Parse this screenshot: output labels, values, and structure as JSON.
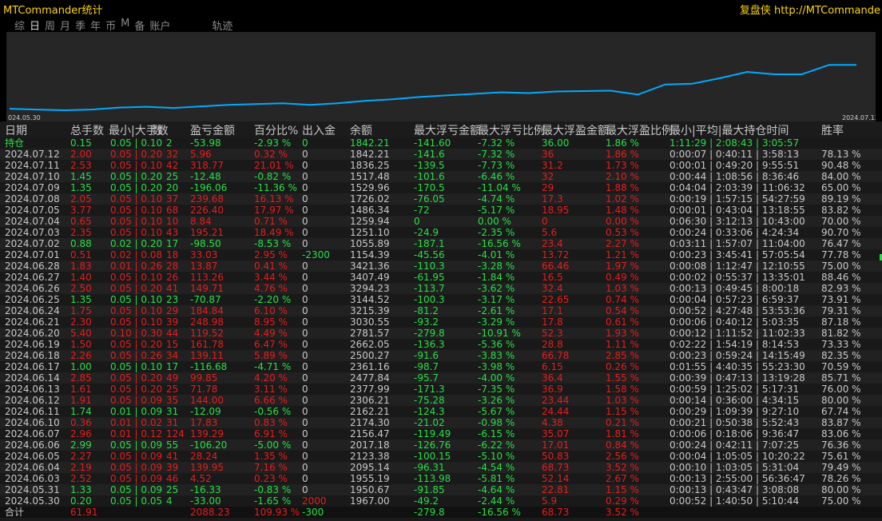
{
  "app": {
    "title": "MTCommander统计",
    "brand": "复盘侠 http://MTCommande"
  },
  "tabs": [
    {
      "label": "综",
      "active": false
    },
    {
      "label": "日",
      "active": true
    },
    {
      "label": "周",
      "active": false
    },
    {
      "label": "月",
      "active": false
    },
    {
      "label": "季",
      "active": false
    },
    {
      "label": "年",
      "active": false
    },
    {
      "label": "币",
      "active": false
    },
    {
      "label": "M",
      "active": false
    },
    {
      "label": "备",
      "active": false
    },
    {
      "label": "账户",
      "active": false
    },
    {
      "label": "轨迹",
      "active": false
    }
  ],
  "chart_data": {
    "type": "line",
    "x_start_label": "024.05.30",
    "x_end_label": "2024.07.12",
    "ylim": [
      1940,
      2800
    ],
    "series": [
      {
        "color": "#00aaff",
        "x": [
          "2024.05.30",
          "2024.05.31",
          "2024.06.03",
          "2024.06.04",
          "2024.06.05",
          "2024.06.06",
          "2024.06.07",
          "2024.06.10",
          "2024.06.11",
          "2024.06.12",
          "2024.06.13",
          "2024.06.14",
          "2024.06.17",
          "2024.06.18",
          "2024.06.19",
          "2024.06.20",
          "2024.06.21",
          "2024.06.24",
          "2024.06.25",
          "2024.06.26",
          "2024.06.27",
          "2024.06.28",
          "2024.07.01",
          "2024.07.02",
          "2024.07.03",
          "2024.07.04",
          "2024.07.05",
          "2024.07.08",
          "2024.07.09",
          "2024.07.10",
          "2024.07.11",
          "2024.07.12"
        ],
        "values": [
          1967.0,
          1950.67,
          1955.19,
          2095.14,
          2123.38,
          2017.18,
          2156.47,
          2174.3,
          2162.21,
          2306.21,
          2377.99,
          2477.84,
          2361.16,
          2500.27,
          2662.05,
          2781.57,
          3030.55,
          3215.39,
          3144.52,
          3294.23,
          3407.49,
          3421.36,
          1154.39,
          1055.89,
          1251.1,
          1259.94,
          1486.34,
          1726.02,
          1529.96,
          1517.48,
          1836.25,
          1842.21
        ]
      }
    ]
  },
  "equity_curve_points": [],
  "table": {
    "headers": [
      "日期",
      "总手数",
      "最小|大手数",
      "数",
      "盈亏金额",
      "百分比%",
      "出入金",
      "余额",
      "最大浮亏金额",
      "最大浮亏比例",
      "最大浮盈金额",
      "最大浮盈比例",
      "最小|平均|最大持仓时间",
      "胜率"
    ],
    "hold": {
      "date": "持仓",
      "lots": "0.15",
      "minmax": "0.05 | 0.10",
      "count": "2",
      "pl": "-53.98",
      "pct": "-2.93 %",
      "flow": "0",
      "bal": "1842.21",
      "mfl": "-141.60",
      "mflp": "-7.32 %",
      "mfp": "36.00",
      "mfpp": "1.86 %",
      "time": "1:11:29 | 2:08:43 | 3:05:57",
      "win": ""
    },
    "rows": [
      {
        "date": "2024.07.12",
        "lots": "2.00",
        "minmax": "0.05 | 0.20",
        "count": "32",
        "pl": "5.96",
        "pct": "0.32 %",
        "flow": "0",
        "bal": "1842.21",
        "mfl": "-141.6",
        "mflp": "-7.32 %",
        "mfp": "36",
        "mfpp": "1.86 %",
        "time": "0:00:07 | 0:40:11 | 3:58:13",
        "win": "78.13 %",
        "sign": "pos"
      },
      {
        "date": "2024.07.11",
        "lots": "2.53",
        "minmax": "0.05 | 0.10",
        "count": "42",
        "pl": "318.77",
        "pct": "21.01 %",
        "flow": "0",
        "bal": "1836.25",
        "mfl": "-139.5",
        "mflp": "-7.73 %",
        "mfp": "31.2",
        "mfpp": "1.73 %",
        "time": "0:00:01 | 0:49:20 | 9:55:51",
        "win": "90.48 %",
        "sign": "pos"
      },
      {
        "date": "2024.07.10",
        "lots": "1.45",
        "minmax": "0.05 | 0.20",
        "count": "25",
        "pl": "-12.48",
        "pct": "-0.82 %",
        "flow": "0",
        "bal": "1517.48",
        "mfl": "-101.6",
        "mflp": "-6.46 %",
        "mfp": "32",
        "mfpp": "2.10 %",
        "time": "0:00:44 | 1:08:56 | 8:36:46",
        "win": "84.00 %",
        "sign": "neg"
      },
      {
        "date": "2024.07.09",
        "lots": "1.35",
        "minmax": "0.05 | 0.20",
        "count": "20",
        "pl": "-196.06",
        "pct": "-11.36 %",
        "flow": "0",
        "bal": "1529.96",
        "mfl": "-170.5",
        "mflp": "-11.04 %",
        "mfp": "29",
        "mfpp": "1.88 %",
        "time": "0:04:04 | 2:03:39 | 11:06:32",
        "win": "65.00 %",
        "sign": "neg"
      },
      {
        "date": "2024.07.08",
        "lots": "2.05",
        "minmax": "0.05 | 0.10",
        "count": "37",
        "pl": "239.68",
        "pct": "16.13 %",
        "flow": "0",
        "bal": "1726.02",
        "mfl": "-76.05",
        "mflp": "-4.74 %",
        "mfp": "17.3",
        "mfpp": "1.02 %",
        "time": "0:00:19 | 1:57:15 | 54:27:59",
        "win": "89.19 %",
        "sign": "pos"
      },
      {
        "date": "2024.07.05",
        "lots": "3.77",
        "minmax": "0.05 | 0.10",
        "count": "68",
        "pl": "226.40",
        "pct": "17.97 %",
        "flow": "0",
        "bal": "1486.34",
        "mfl": "-72",
        "mflp": "-5.17 %",
        "mfp": "18.95",
        "mfpp": "1.48 %",
        "time": "0:00:01 | 0:43:04 | 13:18:55",
        "win": "83.82 %",
        "sign": "pos"
      },
      {
        "date": "2024.07.04",
        "lots": "0.65",
        "minmax": "0.05 | 0.10",
        "count": "10",
        "pl": "8.84",
        "pct": "0.71 %",
        "flow": "0",
        "bal": "1259.94",
        "mfl": "0",
        "mflp": "0.00 %",
        "mfp": "0",
        "mfpp": "0.00 %",
        "time": "0:06:30 | 3:12:13 | 10:43:00",
        "win": "70.00 %",
        "sign": "pos"
      },
      {
        "date": "2024.07.03",
        "lots": "2.35",
        "minmax": "0.05 | 0.10",
        "count": "43",
        "pl": "195.21",
        "pct": "18.49 %",
        "flow": "0",
        "bal": "1251.10",
        "mfl": "-24.9",
        "mflp": "-2.35 %",
        "mfp": "5.6",
        "mfpp": "0.53 %",
        "time": "0:00:24 | 0:33:06 | 4:24:34",
        "win": "90.70 %",
        "sign": "pos"
      },
      {
        "date": "2024.07.02",
        "lots": "0.88",
        "minmax": "0.02 | 0.20",
        "count": "17",
        "pl": "-98.50",
        "pct": "-8.53 %",
        "flow": "0",
        "bal": "1055.89",
        "mfl": "-187.1",
        "mflp": "-16.56 %",
        "mfp": "23.4",
        "mfpp": "2.27 %",
        "time": "0:03:11 | 1:57:07 | 11:04:00",
        "win": "76.47 %",
        "sign": "neg"
      },
      {
        "date": "2024.07.01",
        "lots": "0.51",
        "minmax": "0.02 | 0.08",
        "count": "18",
        "pl": "33.03",
        "pct": "2.95 %",
        "flow": "-2300",
        "bal": "1154.39",
        "mfl": "-45.56",
        "mflp": "-4.01 %",
        "mfp": "13.72",
        "mfpp": "1.21 %",
        "time": "0:00:23 | 3:45:41 | 57:05:54",
        "win": "77.78 %",
        "sign": "pos"
      },
      {
        "date": "2024.06.28",
        "lots": "1.83",
        "minmax": "0.01 | 0.26",
        "count": "28",
        "pl": "13.87",
        "pct": "0.41 %",
        "flow": "0",
        "bal": "3421.36",
        "mfl": "-110.3",
        "mflp": "-3.28 %",
        "mfp": "66.46",
        "mfpp": "1.97 %",
        "time": "0:00:08 | 1:12:47 | 12:10:55",
        "win": "75.00 %",
        "sign": "pos"
      },
      {
        "date": "2024.06.27",
        "lots": "1.40",
        "minmax": "0.05 | 0.10",
        "count": "26",
        "pl": "113.26",
        "pct": "3.44 %",
        "flow": "0",
        "bal": "3407.49",
        "mfl": "-61.95",
        "mflp": "-1.84 %",
        "mfp": "16.5",
        "mfpp": "0.49 %",
        "time": "0:00:02 | 0:55:37 | 13:35:01",
        "win": "88.46 %",
        "sign": "pos"
      },
      {
        "date": "2024.06.26",
        "lots": "2.50",
        "minmax": "0.05 | 0.20",
        "count": "41",
        "pl": "149.71",
        "pct": "4.76 %",
        "flow": "0",
        "bal": "3294.23",
        "mfl": "-113.7",
        "mflp": "-3.62 %",
        "mfp": "32.4",
        "mfpp": "1.03 %",
        "time": "0:00:13 | 0:49:45 | 8:00:18",
        "win": "82.93 %",
        "sign": "pos"
      },
      {
        "date": "2024.06.25",
        "lots": "1.35",
        "minmax": "0.05 | 0.10",
        "count": "23",
        "pl": "-70.87",
        "pct": "-2.20 %",
        "flow": "0",
        "bal": "3144.52",
        "mfl": "-100.3",
        "mflp": "-3.17 %",
        "mfp": "22.65",
        "mfpp": "0.74 %",
        "time": "0:00:04 | 0:57:23 | 6:59:37",
        "win": "73.91 %",
        "sign": "neg"
      },
      {
        "date": "2024.06.24",
        "lots": "1.75",
        "minmax": "0.05 | 0.10",
        "count": "29",
        "pl": "184.84",
        "pct": "6.10 %",
        "flow": "0",
        "bal": "3215.39",
        "mfl": "-81.2",
        "mflp": "-2.61 %",
        "mfp": "17.1",
        "mfpp": "0.54 %",
        "time": "0:00:52 | 4:27:48 | 53:53:36",
        "win": "79.31 %",
        "sign": "pos"
      },
      {
        "date": "2024.06.21",
        "lots": "2.30",
        "minmax": "0.05 | 0.10",
        "count": "39",
        "pl": "248.98",
        "pct": "8.95 %",
        "flow": "0",
        "bal": "3030.55",
        "mfl": "-93.2",
        "mflp": "-3.29 %",
        "mfp": "17.8",
        "mfpp": "0.61 %",
        "time": "0:00:06 | 0:40:12 | 5:03:35",
        "win": "87.18 %",
        "sign": "pos"
      },
      {
        "date": "2024.06.20",
        "lots": "5.40",
        "minmax": "0.10 | 0.30",
        "count": "44",
        "pl": "119.52",
        "pct": "4.49 %",
        "flow": "0",
        "bal": "2781.57",
        "mfl": "-279.8",
        "mflp": "-10.91 %",
        "mfp": "52.3",
        "mfpp": "1.93 %",
        "time": "0:00:12 | 1:11:52 | 11:02:33",
        "win": "81.82 %",
        "sign": "pos"
      },
      {
        "date": "2024.06.19",
        "lots": "1.50",
        "minmax": "0.05 | 0.20",
        "count": "15",
        "pl": "161.78",
        "pct": "6.47 %",
        "flow": "0",
        "bal": "2662.05",
        "mfl": "-136.3",
        "mflp": "-5.36 %",
        "mfp": "28.8",
        "mfpp": "1.11 %",
        "time": "0:02:22 | 1:54:19 | 8:14:53",
        "win": "73.33 %",
        "sign": "pos"
      },
      {
        "date": "2024.06.18",
        "lots": "2.26",
        "minmax": "0.05 | 0.26",
        "count": "34",
        "pl": "139.11",
        "pct": "5.89 %",
        "flow": "0",
        "bal": "2500.27",
        "mfl": "-91.6",
        "mflp": "-3.83 %",
        "mfp": "66.78",
        "mfpp": "2.85 %",
        "time": "0:00:23 | 0:59:24 | 14:15:49",
        "win": "82.35 %",
        "sign": "pos"
      },
      {
        "date": "2024.06.17",
        "lots": "1.00",
        "minmax": "0.05 | 0.10",
        "count": "17",
        "pl": "-116.68",
        "pct": "-4.71 %",
        "flow": "0",
        "bal": "2361.16",
        "mfl": "-98.7",
        "mflp": "-3.98 %",
        "mfp": "6.15",
        "mfpp": "0.26 %",
        "time": "0:01:55 | 4:40:35 | 55:23:30",
        "win": "70.59 %",
        "sign": "neg"
      },
      {
        "date": "2024.06.14",
        "lots": "2.85",
        "minmax": "0.05 | 0.20",
        "count": "49",
        "pl": "99.85",
        "pct": "4.20 %",
        "flow": "0",
        "bal": "2477.84",
        "mfl": "-95.7",
        "mflp": "-4.00 %",
        "mfp": "36.4",
        "mfpp": "1.55 %",
        "time": "0:00:39 | 0:47:13 | 13:19:28",
        "win": "85.71 %",
        "sign": "pos"
      },
      {
        "date": "2024.06.13",
        "lots": "1.61",
        "minmax": "0.05 | 0.20",
        "count": "25",
        "pl": "71.78",
        "pct": "3.11 %",
        "flow": "0",
        "bal": "2377.99",
        "mfl": "-171.3",
        "mflp": "-7.35 %",
        "mfp": "36.9",
        "mfpp": "1.58 %",
        "time": "0:00:59 | 1:25:02 | 5:17:31",
        "win": "76.00 %",
        "sign": "pos"
      },
      {
        "date": "2024.06.12",
        "lots": "1.91",
        "minmax": "0.05 | 0.09",
        "count": "35",
        "pl": "144.00",
        "pct": "6.66 %",
        "flow": "0",
        "bal": "2306.21",
        "mfl": "-75.28",
        "mflp": "-3.26 %",
        "mfp": "23.44",
        "mfpp": "1.03 %",
        "time": "0:00:14 | 0:36:00 | 4:34:15",
        "win": "80.00 %",
        "sign": "pos"
      },
      {
        "date": "2024.06.11",
        "lots": "1.74",
        "minmax": "0.01 | 0.09",
        "count": "31",
        "pl": "-12.09",
        "pct": "-0.56 %",
        "flow": "0",
        "bal": "2162.21",
        "mfl": "-124.3",
        "mflp": "-5.67 %",
        "mfp": "24.44",
        "mfpp": "1.15 %",
        "time": "0:00:29 | 1:09:39 | 9:27:10",
        "win": "67.74 %",
        "sign": "neg"
      },
      {
        "date": "2024.06.10",
        "lots": "0.36",
        "minmax": "0.01 | 0.02",
        "count": "31",
        "pl": "17.83",
        "pct": "0.83 %",
        "flow": "0",
        "bal": "2174.30",
        "mfl": "-21.02",
        "mflp": "-0.98 %",
        "mfp": "4.38",
        "mfpp": "0.21 %",
        "time": "0:00:21 | 0:50:38 | 5:52:43",
        "win": "83.87 %",
        "sign": "pos"
      },
      {
        "date": "2024.06.07",
        "lots": "2.96",
        "minmax": "0.01 | 0.12",
        "count": "124",
        "pl": "139.29",
        "pct": "6.91 %",
        "flow": "0",
        "bal": "2156.47",
        "mfl": "-119.49",
        "mflp": "-6.15 %",
        "mfp": "35.07",
        "mfpp": "1.81 %",
        "time": "0:00:06 | 0:18:06 | 9:36:47",
        "win": "83.06 %",
        "sign": "pos"
      },
      {
        "date": "2024.06.06",
        "lots": "2.99",
        "minmax": "0.05 | 0.09",
        "count": "55",
        "pl": "-106.20",
        "pct": "-5.00 %",
        "flow": "0",
        "bal": "2017.18",
        "mfl": "-126.76",
        "mflp": "-6.22 %",
        "mfp": "17.01",
        "mfpp": "0.84 %",
        "time": "0:00:24 | 0:42:11 | 7:07:25",
        "win": "76.36 %",
        "sign": "neg"
      },
      {
        "date": "2024.06.05",
        "lots": "2.27",
        "minmax": "0.05 | 0.09",
        "count": "41",
        "pl": "28.24",
        "pct": "1.35 %",
        "flow": "0",
        "bal": "2123.38",
        "mfl": "-100.15",
        "mflp": "-5.10 %",
        "mfp": "50.83",
        "mfpp": "2.56 %",
        "time": "0:00:04 | 1:05:05 | 10:20:22",
        "win": "75.61 %",
        "sign": "pos"
      },
      {
        "date": "2024.06.04",
        "lots": "2.19",
        "minmax": "0.05 | 0.09",
        "count": "39",
        "pl": "139.95",
        "pct": "7.16 %",
        "flow": "0",
        "bal": "2095.14",
        "mfl": "-96.31",
        "mflp": "-4.54 %",
        "mfp": "68.73",
        "mfpp": "3.52 %",
        "time": "0:00:10 | 1:03:05 | 5:31:04",
        "win": "79.49 %",
        "sign": "pos"
      },
      {
        "date": "2024.06.03",
        "lots": "2.52",
        "minmax": "0.05 | 0.09",
        "count": "46",
        "pl": "4.52",
        "pct": "0.23 %",
        "flow": "0",
        "bal": "1955.19",
        "mfl": "-113.98",
        "mflp": "-5.81 %",
        "mfp": "52.14",
        "mfpp": "2.67 %",
        "time": "0:00:13 | 2:55:00 | 56:36:47",
        "win": "78.26 %",
        "sign": "pos"
      },
      {
        "date": "2024.05.31",
        "lots": "1.33",
        "minmax": "0.05 | 0.09",
        "count": "25",
        "pl": "-16.33",
        "pct": "-0.83 %",
        "flow": "0",
        "bal": "1950.67",
        "mfl": "-91.85",
        "mflp": "-4.64 %",
        "mfp": "22.81",
        "mfpp": "1.15 %",
        "time": "0:00:13 | 0:43:47 | 3:08:08",
        "win": "80.00 %",
        "sign": "neg"
      },
      {
        "date": "2024.05.30",
        "lots": "0.20",
        "minmax": "0.05 | 0.05",
        "count": "4",
        "pl": "-33.00",
        "pct": "-1.65 %",
        "flow": "2000",
        "bal": "1967.00",
        "mfl": "-49.2",
        "mflp": "-2.44 %",
        "mfp": "5.9",
        "mfpp": "0.29 %",
        "time": "0:00:52 | 1:40:50 | 5:10:44",
        "win": "75.00 %",
        "sign": "neg"
      }
    ],
    "total": {
      "date": "合计",
      "lots": "61.91",
      "pl": "2088.23",
      "pct": "109.93 %",
      "flow": "-300",
      "mfl": "-279.8",
      "mflp": "-16.56 %",
      "mfp": "68.73",
      "mfpp": "3.52 %"
    }
  },
  "colors": {
    "profit": "#e81d1d",
    "loss": "#26e046",
    "line": "#00aaff",
    "title": "#ffd700"
  }
}
